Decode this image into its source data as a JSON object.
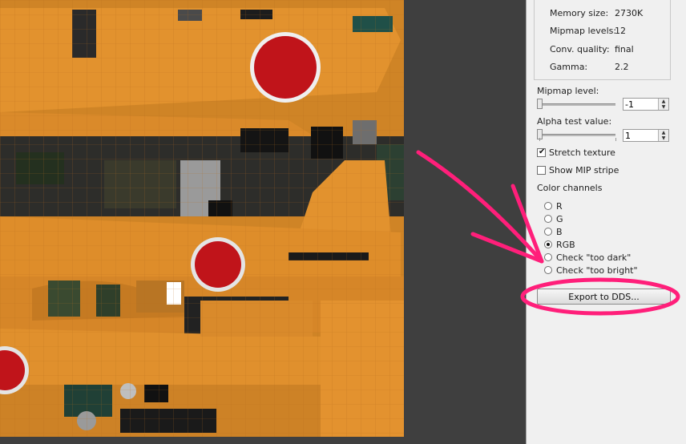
{
  "info": [
    {
      "label": "Memory size:",
      "value": "2730K"
    },
    {
      "label": "Mipmap levels:",
      "value": "12"
    },
    {
      "label": "Conv. quality:",
      "value": "final"
    },
    {
      "label": "Gamma:",
      "value": "2.2"
    }
  ],
  "mipmap": {
    "label": "Mipmap level:",
    "value": "-1"
  },
  "alpha": {
    "label": "Alpha test value:",
    "value": "1"
  },
  "stretch": {
    "label": "Stretch texture",
    "checked": true
  },
  "show_mip": {
    "label": "Show MIP stripe",
    "checked": false
  },
  "channels": {
    "title": "Color channels",
    "options": [
      {
        "label": "R",
        "selected": false
      },
      {
        "label": "G",
        "selected": false
      },
      {
        "label": "B",
        "selected": false
      },
      {
        "label": "RGB",
        "selected": true
      },
      {
        "label": "Check \"too dark\"",
        "selected": false
      },
      {
        "label": "Check \"too bright\"",
        "selected": false
      }
    ]
  },
  "export_label": "Export to DDS...",
  "colors": {
    "texture_orange": "#d88a2a",
    "hinomaru_red": "#c0141a",
    "annotation_pink": "#ff1f7a",
    "panel_bg": "#f0f0f0"
  }
}
